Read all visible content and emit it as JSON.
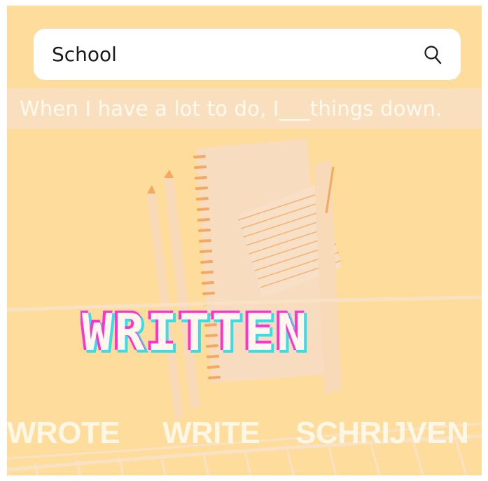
{
  "search": {
    "value": "School",
    "icon": "search-icon"
  },
  "prompt": {
    "sentence": "When I have a lot to do, I___things down."
  },
  "title": {
    "word": "WRITTEN"
  },
  "answers": {
    "option1": "WROTE",
    "option2": "WRITE",
    "option3": "SCHRIJVEN"
  },
  "colors": {
    "background": "#fddc9c",
    "band": "#f9dfbd",
    "paper": "#f7dfc0",
    "accent_orange": "#f4a860",
    "title_magenta": "#ff33cc",
    "title_cyan": "#33e0e8"
  }
}
